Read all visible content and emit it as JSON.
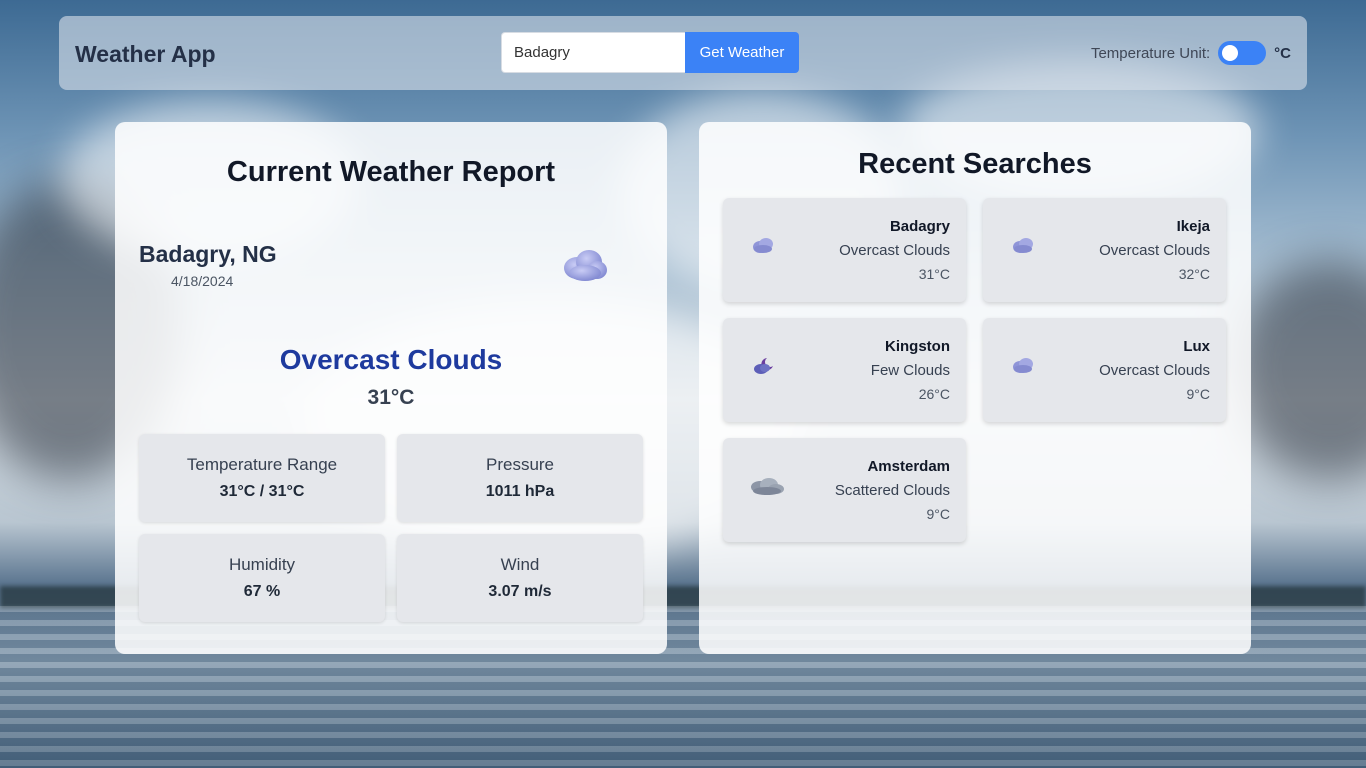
{
  "navbar": {
    "brand": "Weather App",
    "search_value": "Badagry",
    "search_button": "Get Weather",
    "unit_label": "Temperature Unit:",
    "unit_value": "°C",
    "unit_toggle_on": true
  },
  "current": {
    "title": "Current Weather Report",
    "location": "Badagry, NG",
    "date": "4/18/2024",
    "icon": "overcast-clouds-icon",
    "condition": "Overcast Clouds",
    "temperature": "31°C",
    "stats": [
      {
        "label": "Temperature Range",
        "value": "31°C / 31°C"
      },
      {
        "label": "Pressure",
        "value": "1011 hPa"
      },
      {
        "label": "Humidity",
        "value": "67 %"
      },
      {
        "label": "Wind",
        "value": "3.07 m/s"
      }
    ]
  },
  "recent": {
    "title": "Recent Searches",
    "items": [
      {
        "city": "Badagry",
        "condition": "Overcast Clouds",
        "temp": "31°C",
        "icon": "overcast-clouds-icon"
      },
      {
        "city": "Ikeja",
        "condition": "Overcast Clouds",
        "temp": "32°C",
        "icon": "overcast-clouds-icon"
      },
      {
        "city": "Kingston",
        "condition": "Few Clouds",
        "temp": "26°C",
        "icon": "few-clouds-night-icon"
      },
      {
        "city": "Lux",
        "condition": "Overcast Clouds",
        "temp": "9°C",
        "icon": "overcast-clouds-icon"
      },
      {
        "city": "Amsterdam",
        "condition": "Scattered Clouds",
        "temp": "9°C",
        "icon": "scattered-clouds-icon"
      }
    ]
  },
  "colors": {
    "accent": "#3b82f6",
    "condition_text": "#1e3a9e",
    "card_bg": "#e5e7eb",
    "cloud_icon": "#8f95d8"
  }
}
